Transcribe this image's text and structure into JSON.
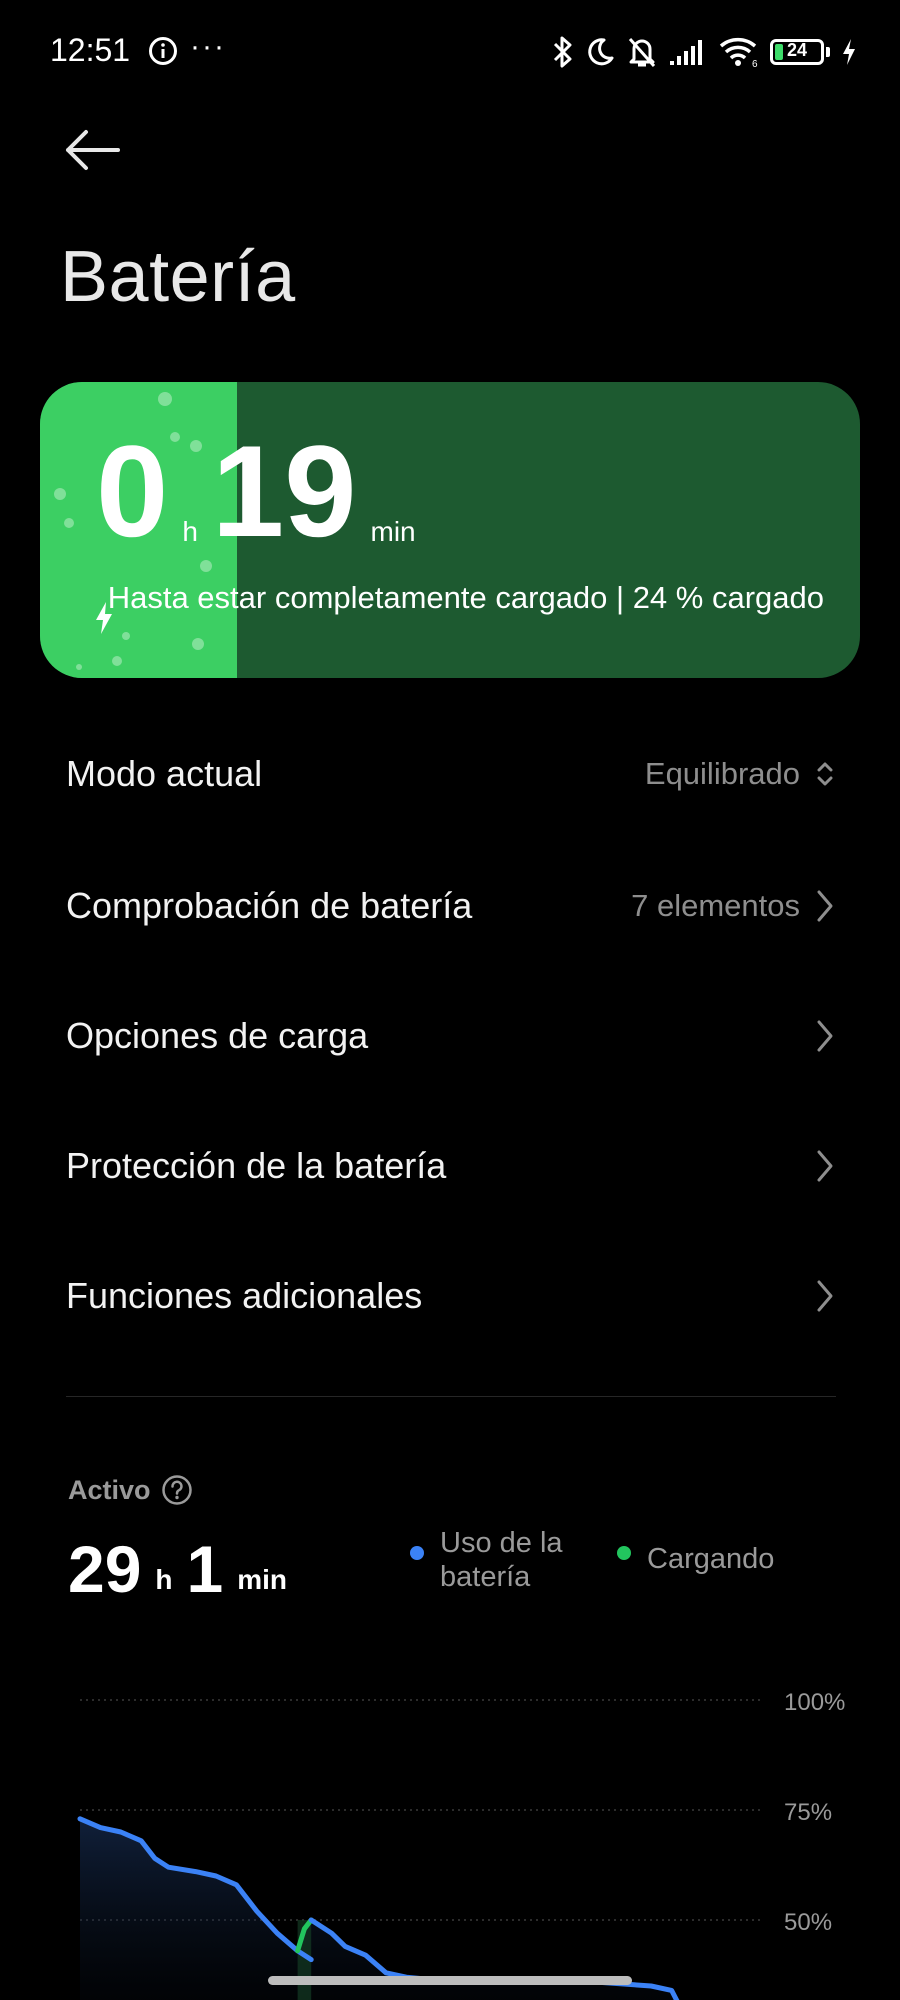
{
  "status_bar": {
    "time": "12:51",
    "dots": "···",
    "battery_level": "24",
    "battery_fraction": 0.24,
    "icons": [
      "info-icon",
      "bluetooth-icon",
      "moon-icon",
      "bell-off-icon",
      "signal-icon",
      "wifi-icon",
      "battery-icon",
      "charging-icon"
    ]
  },
  "header": {
    "title": "Batería"
  },
  "charge_card": {
    "hours": "0",
    "hours_unit": "h",
    "minutes": "19",
    "minutes_unit": "min",
    "status": "Hasta estar completamente cargado | 24 % cargado",
    "charge_fraction": 0.24,
    "accent": "#3ccf63",
    "background": "#1d5a30"
  },
  "settings": {
    "mode": {
      "label": "Modo actual",
      "value": "Equilibrado"
    },
    "check": {
      "label": "Comprobación de batería",
      "value": "7 elementos"
    },
    "charging_options": {
      "label": "Opciones de carga"
    },
    "protection": {
      "label": "Protección de la batería"
    },
    "additional": {
      "label": "Funciones adicionales"
    }
  },
  "activity": {
    "label": "Activo",
    "hours": "29",
    "hours_unit": "h",
    "minutes": "1",
    "minutes_unit": "min",
    "legend_usage": [
      "Uso de la",
      "batería"
    ],
    "legend_charging": "Cargando",
    "usage_color": "#3b82f6",
    "charging_color": "#22c55e"
  },
  "chart_data": {
    "type": "line",
    "y_ticks": [
      "100%",
      "75%",
      "50%"
    ],
    "ylim": [
      0,
      100
    ],
    "grid": true,
    "series": [
      {
        "name": "Uso de la batería",
        "color": "#3b82f6",
        "points": [
          [
            0,
            73
          ],
          [
            3,
            71
          ],
          [
            6,
            70
          ],
          [
            9,
            68
          ],
          [
            11,
            64
          ],
          [
            13,
            62
          ],
          [
            17,
            61
          ],
          [
            20,
            60
          ],
          [
            23,
            58
          ],
          [
            26,
            52
          ],
          [
            29,
            47
          ],
          [
            32,
            43
          ],
          [
            34,
            41
          ]
        ]
      },
      {
        "name": "Cargando",
        "color": "#22c55e",
        "points": [
          [
            32,
            43
          ],
          [
            33,
            48
          ],
          [
            34,
            50
          ]
        ]
      },
      {
        "name": "Uso de la batería",
        "color": "#3b82f6",
        "points": [
          [
            34,
            50
          ],
          [
            37,
            47
          ],
          [
            39,
            44
          ],
          [
            42,
            42
          ],
          [
            45,
            38
          ],
          [
            48,
            37
          ],
          [
            55,
            36
          ],
          [
            65,
            36
          ],
          [
            75,
            36
          ],
          [
            84,
            35
          ],
          [
            87,
            34
          ],
          [
            88,
            31
          ]
        ]
      }
    ]
  }
}
